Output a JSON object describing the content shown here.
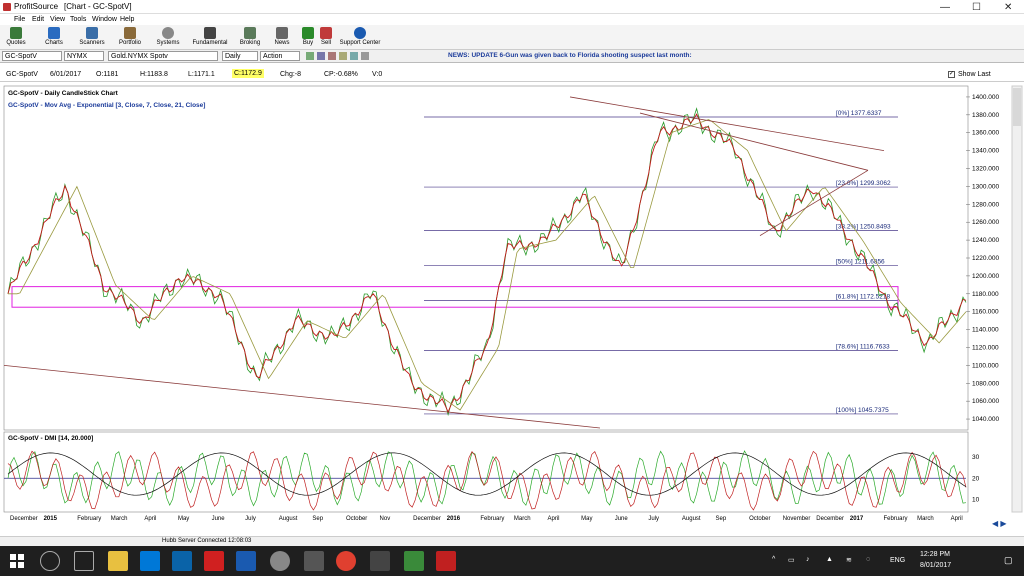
{
  "window": {
    "app_name": "ProfitSource",
    "title": "[Chart - GC-SpotV]",
    "minimize": "—",
    "maximize": "☐",
    "close": "✕"
  },
  "menu": [
    "File",
    "Edit",
    "View",
    "Tools",
    "Window",
    "Help"
  ],
  "toolbar": [
    {
      "label": "Quotes",
      "color": "#3a7a3a"
    },
    {
      "label": "Charts",
      "color": "#2a6bc0"
    },
    {
      "label": "Scanners",
      "color": "#3a6ea8"
    },
    {
      "label": "Portfolio",
      "color": "#8a6a3a"
    },
    {
      "label": "Systems",
      "color": "#888888"
    },
    {
      "label": "Fundamental",
      "color": "#444444"
    },
    {
      "label": "Broking",
      "color": "#5a7a5a"
    },
    {
      "label": "News",
      "color": "#666666"
    },
    {
      "label": "Buy",
      "color": "#2a8a2a"
    },
    {
      "label": "Sell",
      "color": "#c03a3a"
    },
    {
      "label": "Support Center",
      "color": "#1a5ab0"
    }
  ],
  "symbolbar": {
    "symbol": "GC-SpotV",
    "exchange": "NYMX",
    "description": "Gold.NYMX Spotv",
    "period": "Daily",
    "action": "Action",
    "news": "NEWS: UPDATE 6-Gun was given back to Florida shooting suspect last month:"
  },
  "infobar": {
    "symbol": "GC-SpotV",
    "date": "6/01/2017",
    "open": "O:1181",
    "high": "H:1183.8",
    "low": "L:1171.1",
    "close": "C:1172.9",
    "change": "Chg:-8",
    "change_pct": "CP:-0.68%",
    "volume": "V:0",
    "show_last": "Show Last"
  },
  "chart_data": {
    "type": "line",
    "title": "GC-SpotV - Daily CandleStick Chart",
    "indicator_label": "GC-SpotV - Mov Avg - Exponential [3, Close, 7, Close, 21, Close]",
    "ylim": [
      1030,
      1410
    ],
    "yticks": [
      "1400.000",
      "1380.000",
      "1360.000",
      "1340.000",
      "1320.000",
      "1300.000",
      "1280.000",
      "1260.000",
      "1240.000",
      "1220.000",
      "1200.000",
      "1180.000",
      "1160.000",
      "1140.000",
      "1120.000",
      "1100.000",
      "1080.000",
      "1060.000",
      "1040.000"
    ],
    "fib_levels": [
      {
        "label": "[0%] 1377.6337",
        "value": 1377.63
      },
      {
        "label": "[23.6%] 1299.3062",
        "value": 1299.31
      },
      {
        "label": "[38.2%] 1250.8493",
        "value": 1250.85
      },
      {
        "label": "[50%] 1211.6856",
        "value": 1211.69
      },
      {
        "label": "[61.8%] 1172.5218",
        "value": 1172.52
      },
      {
        "label": "[78.6%] 1116.7633",
        "value": 1116.76
      },
      {
        "label": "[100%] 1045.7375",
        "value": 1045.74
      }
    ],
    "price": {
      "x": [
        0,
        0.06,
        0.1,
        0.14,
        0.18,
        0.22,
        0.26,
        0.3,
        0.34,
        0.38,
        0.42,
        0.46,
        0.5,
        0.52,
        0.56,
        0.6,
        0.64,
        0.68,
        0.72,
        0.76,
        0.8,
        0.84,
        0.88,
        0.92,
        0.96,
        1.0
      ],
      "values": [
        1180,
        1300,
        1190,
        1150,
        1200,
        1180,
        1085,
        1150,
        1130,
        1180,
        1080,
        1050,
        1120,
        1230,
        1240,
        1290,
        1205,
        1360,
        1375,
        1340,
        1250,
        1300,
        1240,
        1170,
        1125,
        1175
      ]
    },
    "dmi_label": "GC-SpotV - DMI [14, 20.000]",
    "dmi_yticks": [
      "30",
      "20",
      "10"
    ],
    "dmi_ylim": [
      5,
      40
    ],
    "xticks": [
      "December",
      "2015",
      "February",
      "March",
      "April",
      "May",
      "June",
      "July",
      "August",
      "Sep",
      "October",
      "Nov",
      "December",
      "2016",
      "February",
      "March",
      "April",
      "May",
      "June",
      "July",
      "August",
      "Sep",
      "October",
      "November",
      "December",
      "2017",
      "February",
      "March",
      "April"
    ]
  },
  "status": {
    "server": "Hubb Server Connected 12:08:03"
  },
  "taskbar": {
    "time": "12:28 PM",
    "date": "8/01/2017",
    "lang": "ENG"
  }
}
